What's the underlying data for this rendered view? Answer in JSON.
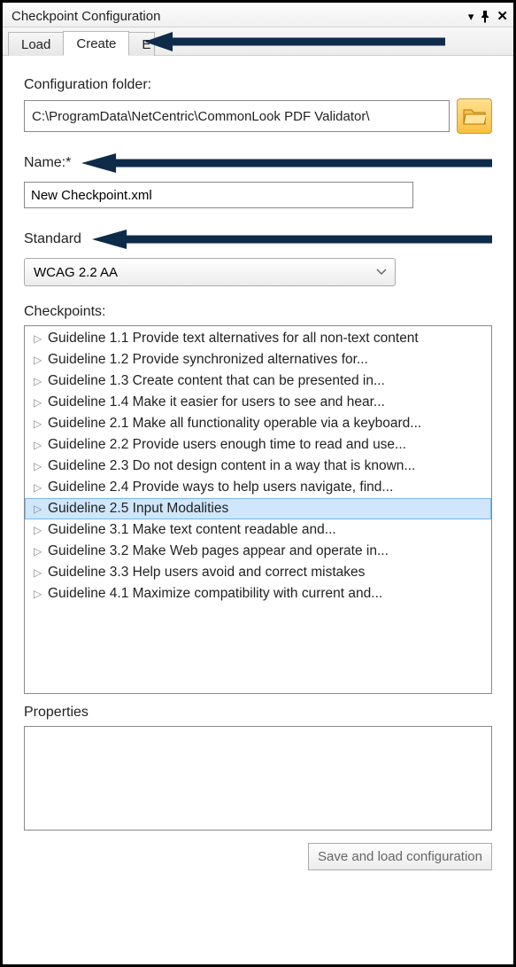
{
  "window": {
    "title": "Checkpoint Configuration"
  },
  "tabs": {
    "load": "Load",
    "create": "Create",
    "hidden_initial": "E"
  },
  "form": {
    "folder_label": "Configuration folder:",
    "folder_value": "C:\\ProgramData\\NetCentric\\CommonLook PDF Validator\\",
    "name_label": "Name:*",
    "name_value": "New Checkpoint.xml",
    "standard_label": "Standard",
    "standard_value": "WCAG 2.2 AA",
    "checkpoints_label": "Checkpoints:",
    "properties_label": "Properties",
    "save_button": "Save and load configuration"
  },
  "checkpoints": [
    {
      "label": "Guideline 1.1 Provide text alternatives for all non-text content",
      "selected": false
    },
    {
      "label": "Guideline 1.2 Provide synchronized alternatives for...",
      "selected": false
    },
    {
      "label": "Guideline 1.3 Create content that can be presented in...",
      "selected": false
    },
    {
      "label": "Guideline 1.4 Make it easier for users to see and hear...",
      "selected": false
    },
    {
      "label": "Guideline 2.1 Make all functionality operable via a keyboard...",
      "selected": false
    },
    {
      "label": "Guideline 2.2 Provide users enough time to read and use...",
      "selected": false
    },
    {
      "label": "Guideline 2.3 Do not design content in a way that is known...",
      "selected": false
    },
    {
      "label": "Guideline 2.4 Provide ways to help users navigate, find...",
      "selected": false
    },
    {
      "label": "Guideline 2.5 Input Modalities",
      "selected": true
    },
    {
      "label": "Guideline 3.1 Make text content readable and...",
      "selected": false
    },
    {
      "label": "Guideline 3.2 Make Web pages appear and operate in...",
      "selected": false
    },
    {
      "label": "Guideline 3.3 Help users avoid and correct mistakes",
      "selected": false
    },
    {
      "label": "Guideline 4.1 Maximize compatibility with current and...",
      "selected": false
    }
  ],
  "colors": {
    "arrow": "#0f2b4a",
    "selection_bg": "#cfe6fb",
    "selection_border": "#7bb6ec"
  }
}
